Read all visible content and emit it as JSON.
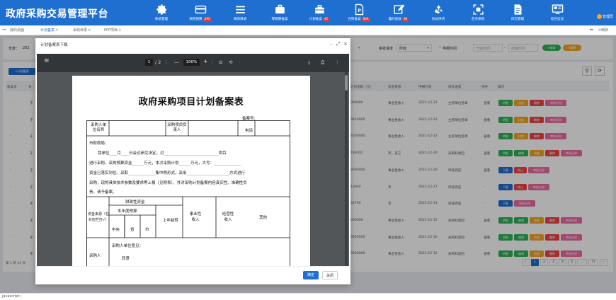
{
  "app": {
    "title": "政府采购交易管理平台",
    "user": "管理员"
  },
  "nav": [
    {
      "label": "系统管理",
      "badge": ""
    },
    {
      "label": "采购预算",
      "badge": "295"
    },
    {
      "label": "采购目录",
      "badge": ""
    },
    {
      "label": "零额算备案",
      "badge": ""
    },
    {
      "label": "计划备案",
      "badge": "45"
    },
    {
      "label": "合同备案",
      "badge": "664"
    },
    {
      "label": "履约验收",
      "badge": "89"
    },
    {
      "label": "协议供货",
      "badge": ""
    },
    {
      "label": "定点采购",
      "badge": ""
    },
    {
      "label": "日志管理",
      "badge": ""
    },
    {
      "label": "综合信息",
      "badge": ""
    }
  ],
  "tabs": [
    "我的桌面",
    "计划备案",
    "采购目录",
    "PPP项目"
  ],
  "tabbar_right": "刷新",
  "filters": {
    "year_label": "年度：",
    "year_value": "202",
    "status_label": "审批进度",
    "status_value": "所有",
    "date_label": "申报时间",
    "date_start": "开始时间",
    "date_end": "结束时间",
    "search": "搜索",
    "reset": "重置",
    "dash": "-"
  },
  "add_button": "计划备案",
  "table": {
    "left_headers": [
      "备案号",
      "采"
    ],
    "headers": [
      "计划金额（元）",
      "资金来源",
      "申报时间",
      "审批进度",
      "附件",
      "操作"
    ],
    "rows": [
      {
        "amount": "000000",
        "source": "事业性收入",
        "date": "2021-12-22",
        "status": "主管单位签章",
        "attach": "查看",
        "actions": [
          "明细",
          "进度",
          "删除",
          "审核历程"
        ]
      },
      {
        "amount": "3650000",
        "source": "事业性收入",
        "date": "2021-12-22",
        "status": "主管单位签章",
        "attach": "查看",
        "actions": [
          "明细",
          "进度",
          "删除",
          "审核历程"
        ]
      },
      {
        "amount": "3500000",
        "source": "事业性收入",
        "date": "2021-12-22",
        "status": "主管单位签章",
        "attach": "查看",
        "actions": [
          "明细",
          "进度",
          "删除",
          "审核历程"
        ]
      },
      {
        "amount": "?30000",
        "source": "市、其它",
        "date": "2021-12-20",
        "status": "采购科退回",
        "attach": "查看",
        "actions": [
          "明细",
          "编辑",
          "进度",
          "删除",
          "审核历程"
        ]
      },
      {
        "amount": "3000000",
        "source": "事业性收入",
        "date": "2021-12-20",
        "status": "审核完成",
        "attach": "查看",
        "actions": [
          "下载",
          "终止",
          "审核历程"
        ]
      },
      {
        "amount": "13900",
        "source": "市",
        "date": "2021-12-17",
        "status": "审核完成",
        "attach": "-",
        "actions": [
          "下载",
          "终止",
          "审核历程"
        ]
      },
      {
        "amount": "35790",
        "source": "市",
        "date": "2021-12-13",
        "status": "审核完成",
        "attach": "-",
        "actions": [
          "下载",
          "审核历程"
        ]
      },
      {
        "amount": "000000",
        "source": "事业性收入",
        "date": "2021-12-10",
        "status": "采购科退回",
        "attach": "查看",
        "actions": [
          "明细",
          "编辑",
          "进度",
          "删除",
          "审核历程"
        ]
      },
      {
        "amount": "3650000",
        "source": "事业性收入",
        "date": "2021-12-10",
        "status": "采购科退回",
        "attach": "查看",
        "actions": [
          "明细",
          "编辑",
          "进度",
          "删除",
          "审核历程"
        ]
      },
      {
        "amount": "3500000",
        "source": "事业性收入",
        "date": "2021-12-10",
        "status": "采购科退回",
        "attach": "查看",
        "actions": [
          "明细",
          "编辑",
          "进度",
          "删除",
          "审核历程"
        ]
      }
    ]
  },
  "pager": {
    "info": "第 1 到 10 条",
    "pages": [
      "‹",
      "1",
      "2",
      "3",
      "4",
      "5",
      "...",
      "71",
      "›"
    ]
  },
  "dialog": {
    "title": "计划备案表下载",
    "page_current": "1",
    "page_total": "/ 2",
    "zoom": "100%",
    "confirm": "确定",
    "close": "关闭"
  },
  "doc": {
    "title": "政府采购项目计划备案表",
    "record_no": "备案号:",
    "purchaser": "采购人单位名称",
    "leader": "采购项目负责人",
    "phone": "电话",
    "bureau": "市财政局：",
    "para1": "我单位____月____日会议研究决定，对____________________________项目",
    "para2": "进行采购，采购预算资金______万元，本次采购计划______万元，大写：______________",
    "para3": "资金已落实到位。采取______________集中购形式，采用______________________方式进行",
    "para4": "采购，现将具体技术参数及要求等上报（见附表），并对采购计划备案内容真实性、准确性负",
    "para5": "责，请予备案。",
    "fund_source": "资金来源（在对应栏打√）",
    "fiscal": "财政性资金",
    "annual_budget": "本年度预算",
    "central": "中央",
    "province": "省",
    "city": "市",
    "carryover": "上年结转",
    "business": "事业性收入",
    "operating": "经营性收入",
    "other": "其他",
    "purchaser_opinion_label": "采购人",
    "purchaser_opinion": "采购人单位意见：",
    "agree": "同意"
  },
  "status_bar": "javascript:;"
}
